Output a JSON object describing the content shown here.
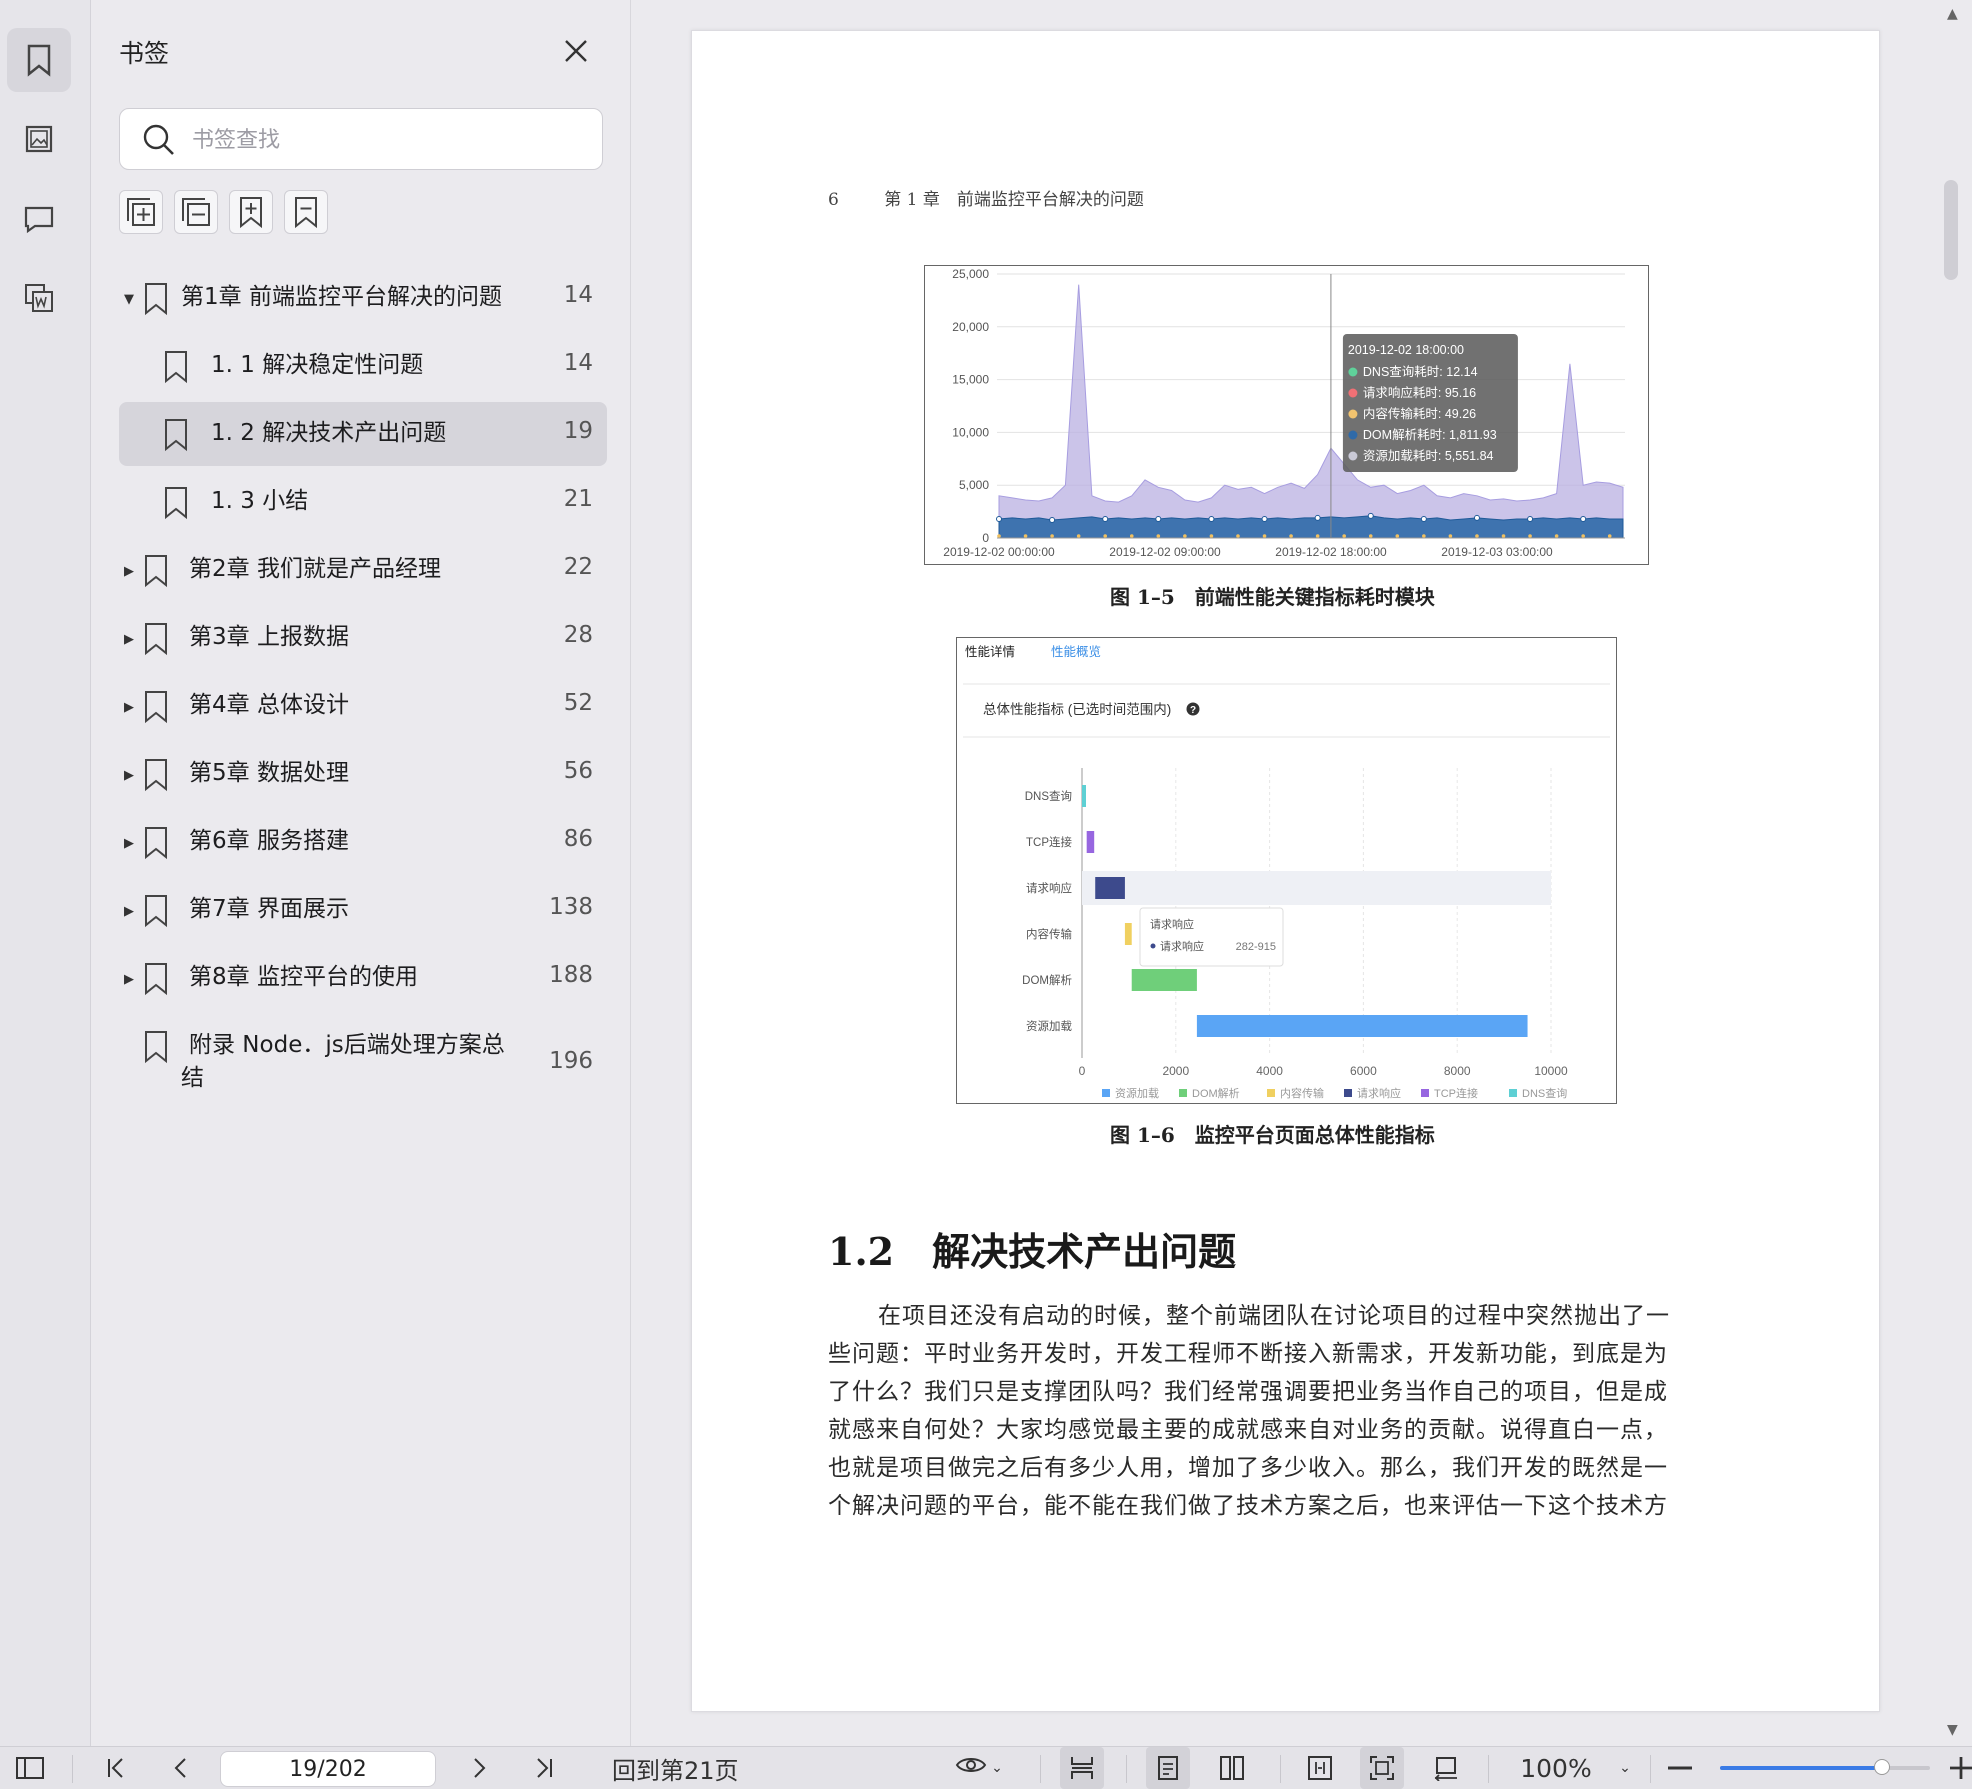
{
  "sidebar": {
    "title": "书签",
    "search_placeholder": "书签查找",
    "items": [
      {
        "label": "第1章 前端监控平台解决的问题",
        "page": "14"
      },
      {
        "label": "1. 1 解决稳定性问题",
        "page": "14"
      },
      {
        "label": "1. 2 解决技术产出问题",
        "page": "19"
      },
      {
        "label": "1. 3 小结",
        "page": "21"
      },
      {
        "label": "第2章 我们就是产品经理",
        "page": "22"
      },
      {
        "label": "第3章 上报数据",
        "page": "28"
      },
      {
        "label": "第4章 总体设计",
        "page": "52"
      },
      {
        "label": "第5章 数据处理",
        "page": "56"
      },
      {
        "label": "第6章 服务搭建",
        "page": "86"
      },
      {
        "label": "第7章 界面展示",
        "page": "138"
      },
      {
        "label": "第8章 监控平台的使用",
        "page": "188"
      },
      {
        "label_line1": "附录 Node．js后端处理方案总",
        "label_line2": "结",
        "page": "196"
      }
    ]
  },
  "document": {
    "page_number": "6",
    "running_header": "第 1 章　前端监控平台解决的问题",
    "figure1_caption": "图 1–5　前端性能关键指标耗时模块",
    "figure2_caption": "图 1–6　监控平台页面总体性能指标",
    "section_heading": "1.2　解决技术产出问题",
    "paragraph_lines": [
      "在项目还没有启动的时候，整个前端团队在讨论项目的过程中突然抛出了一",
      "些问题：平时业务开发时，开发工程师不断接入新需求，开发新功能，到底是为",
      "了什么？我们只是支撑团队吗？我们经常强调要把业务当作自己的项目，但是成",
      "就感来自何处？大家均感觉最主要的成就感来自对业务的贡献。说得直白一点，",
      "也就是项目做完之后有多少人用，增加了多少收入。那么，我们开发的既然是一",
      "个解决问题的平台，能不能在我们做了技术方案之后，也来评估一下这个技术方"
    ]
  },
  "chart_data": [
    {
      "type": "area",
      "x_tick_labels": [
        "2019-12-02 00:00:00",
        "2019-12-02 09:00:00",
        "2019-12-02 18:00:00",
        "2019-12-03 03:00:00"
      ],
      "y_tick_labels": [
        "0",
        "5,000",
        "10,000",
        "15,000",
        "20,000",
        "25,000"
      ],
      "ylim": [
        0,
        25000
      ],
      "series": [
        {
          "name": "资源加载耗时",
          "color": "#b9b0e2",
          "values": [
            4000,
            3800,
            3600,
            3500,
            3800,
            5000,
            24000,
            4000,
            3500,
            3400,
            4000,
            5500,
            4800,
            4500,
            3600,
            3400,
            3800,
            5000,
            4600,
            4800,
            4200,
            4800,
            5200,
            4700,
            6000,
            8500,
            7000,
            5500,
            4800,
            5000,
            4200,
            4500,
            5000,
            4000,
            3800,
            4200,
            4000,
            3600,
            3700,
            3500,
            3600,
            3800,
            4200,
            16500,
            5000,
            5300,
            5200,
            4800
          ]
        },
        {
          "name": "DOM解析耗时",
          "color": "#2f6aa8",
          "values": [
            1800,
            1900,
            1800,
            1900,
            1700,
            1800,
            1900,
            2000,
            1800,
            1900,
            1800,
            1900,
            1800,
            1900,
            1800,
            1900,
            1800,
            1900,
            1800,
            1900,
            1800,
            1900,
            1800,
            1900,
            1900,
            2000,
            1900,
            2000,
            2100,
            1900,
            1800,
            1900,
            1800,
            1900,
            1700,
            1800,
            1900,
            1800,
            1700,
            1800,
            1800,
            1900,
            1800,
            1900,
            1800,
            1900,
            1800,
            1800
          ]
        }
      ],
      "tooltip": {
        "title": "2019-12-02 18:00:00",
        "rows": [
          {
            "label": "DNS查询耗时: 12.14",
            "color": "#5fd19a"
          },
          {
            "label": "请求响应耗时: 95.16",
            "color": "#f07075"
          },
          {
            "label": "内容传输耗时: 49.26",
            "color": "#f3c46f"
          },
          {
            "label": "DOM解析耗时: 1,811.93",
            "color": "#2f6aa8"
          },
          {
            "label": "资源加载耗时: 5,551.84",
            "color": "#c9c9d6"
          }
        ]
      }
    },
    {
      "type": "bar",
      "tabs": [
        "性能详情",
        "性能概览"
      ],
      "panel_title": "总体性能指标 (已选时间范围内)",
      "categories": [
        "DNS查询",
        "TCP连接",
        "请求响应",
        "内容传输",
        "DOM解析",
        "资源加载"
      ],
      "ranges": [
        [
          0,
          80
        ],
        [
          100,
          260
        ],
        [
          282,
          915
        ],
        [
          915,
          1060
        ],
        [
          1060,
          2450
        ],
        [
          2450,
          9500
        ]
      ],
      "colors": [
        "#5ed0d4",
        "#9766e0",
        "#3d4a8c",
        "#f0d060",
        "#6fcf7a",
        "#5aa5f5"
      ],
      "x_ticks": [
        "0",
        "2000",
        "4000",
        "6000",
        "8000",
        "10000"
      ],
      "xlim": [
        0,
        10000
      ],
      "legend": [
        "资源加载",
        "DOM解析",
        "内容传输",
        "请求响应",
        "TCP连接",
        "DNS查询"
      ],
      "tooltip": {
        "title": "请求响应",
        "label": "请求响应",
        "value": "282-915"
      }
    }
  ],
  "bottombar": {
    "page_value": "19/202",
    "goto_label": "回到第21页",
    "zoom": "100%",
    "zoom_fraction": 0.77
  }
}
